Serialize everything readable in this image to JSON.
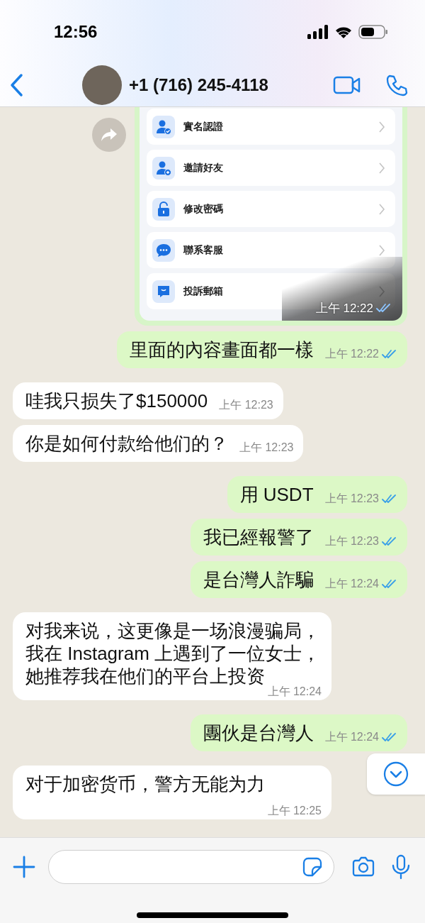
{
  "status_bar": {
    "time": "12:56"
  },
  "header": {
    "contact": "+1 (716) 245-4118"
  },
  "messages": [
    {
      "kind": "image",
      "outgoing": true,
      "items": [
        {
          "label": "實名認證"
        },
        {
          "label": "邀請好友"
        },
        {
          "label": "修改密碼"
        },
        {
          "label": "聯系客服"
        },
        {
          "label": "投訴郵箱"
        }
      ],
      "time": "上午 12:22",
      "read": true
    },
    {
      "kind": "text",
      "outgoing": true,
      "text": "里面的內容畫面都一樣",
      "time": "上午 12:22",
      "read": true
    },
    {
      "kind": "text",
      "outgoing": false,
      "text": "哇我只损失了$150000",
      "time": "上午 12:23"
    },
    {
      "kind": "text",
      "outgoing": false,
      "text": "你是如何付款给他们的？",
      "time": "上午 12:23"
    },
    {
      "kind": "text",
      "outgoing": true,
      "text": "用 USDT",
      "time": "上午 12:23",
      "read": true
    },
    {
      "kind": "text",
      "outgoing": true,
      "text": "我已經報警了",
      "time": "上午 12:23",
      "read": true
    },
    {
      "kind": "text",
      "outgoing": true,
      "text": "是台灣人詐騙",
      "time": "上午 12:24",
      "read": true
    },
    {
      "kind": "text",
      "outgoing": false,
      "text": "对我来说，这更像是一场浪漫骗局，我在 Instagram 上遇到了一位女士，她推荐我在他们的平台上投资",
      "time": "上午 12:24"
    },
    {
      "kind": "text",
      "outgoing": true,
      "text": "團伙是台灣人",
      "time": "上午 12:24",
      "read": true
    },
    {
      "kind": "text",
      "outgoing": false,
      "text": "对于加密货币，警方无能为力",
      "time": "上午 12:25"
    }
  ]
}
